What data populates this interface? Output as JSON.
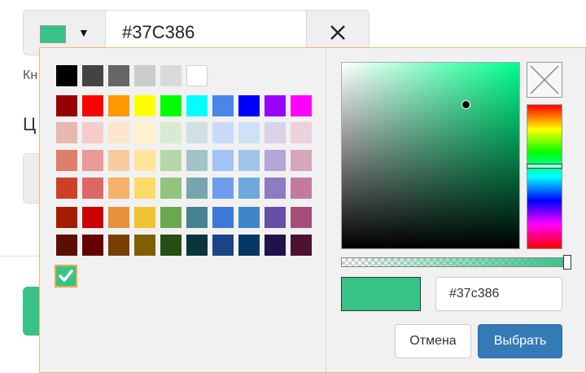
{
  "background": {
    "label_kn": "Кн",
    "label_ts": "Ц"
  },
  "control": {
    "current_color": "#37C386",
    "caret_icon": "caret-down-icon",
    "clear_icon": "close-icon"
  },
  "palette": {
    "rows": [
      [
        "#000000",
        "#434343",
        "#666666",
        "#cccccc",
        "#d9d9d9",
        "#ffffff"
      ],
      [
        "#980000",
        "#ff0000",
        "#ff9900",
        "#ffff00",
        "#00ff00",
        "#00ffff",
        "#4a86e8",
        "#0000ff",
        "#9900ff",
        "#ff00ff"
      ],
      [
        "#e6b8af",
        "#f4cccc",
        "#fce5cd",
        "#fff2cc",
        "#d9ead3",
        "#d0e0e3",
        "#c9daf8",
        "#cfe2f3",
        "#d9d2e9",
        "#ead1dc"
      ],
      [
        "#dd7e6b",
        "#ea9999",
        "#f9cb9c",
        "#ffe599",
        "#b6d7a8",
        "#a2c4c9",
        "#a4c2f4",
        "#9fc5e8",
        "#b4a7d6",
        "#d5a6bd"
      ],
      [
        "#cc4125",
        "#e06666",
        "#f6b26b",
        "#ffd966",
        "#93c47d",
        "#76a5af",
        "#6d9eeb",
        "#6fa8dc",
        "#8e7cc3",
        "#c27ba0"
      ],
      [
        "#a61c00",
        "#cc0000",
        "#e69138",
        "#f1c232",
        "#6aa84f",
        "#45818e",
        "#3c78d8",
        "#3d85c6",
        "#674ea7",
        "#a64d79"
      ],
      [
        "#5b0f00",
        "#660000",
        "#783f04",
        "#7f6000",
        "#274e13",
        "#0c343d",
        "#1c4587",
        "#073763",
        "#20124d",
        "#4c1130"
      ]
    ],
    "selected_color": "#37c386",
    "selected_icon": "checkmark-icon"
  },
  "picker": {
    "hue_color": "#00ff8c",
    "no_color_icon": "no-color-icon",
    "hex_value": "#37c386",
    "cancel_label": "Отмена",
    "choose_label": "Выбрать"
  }
}
